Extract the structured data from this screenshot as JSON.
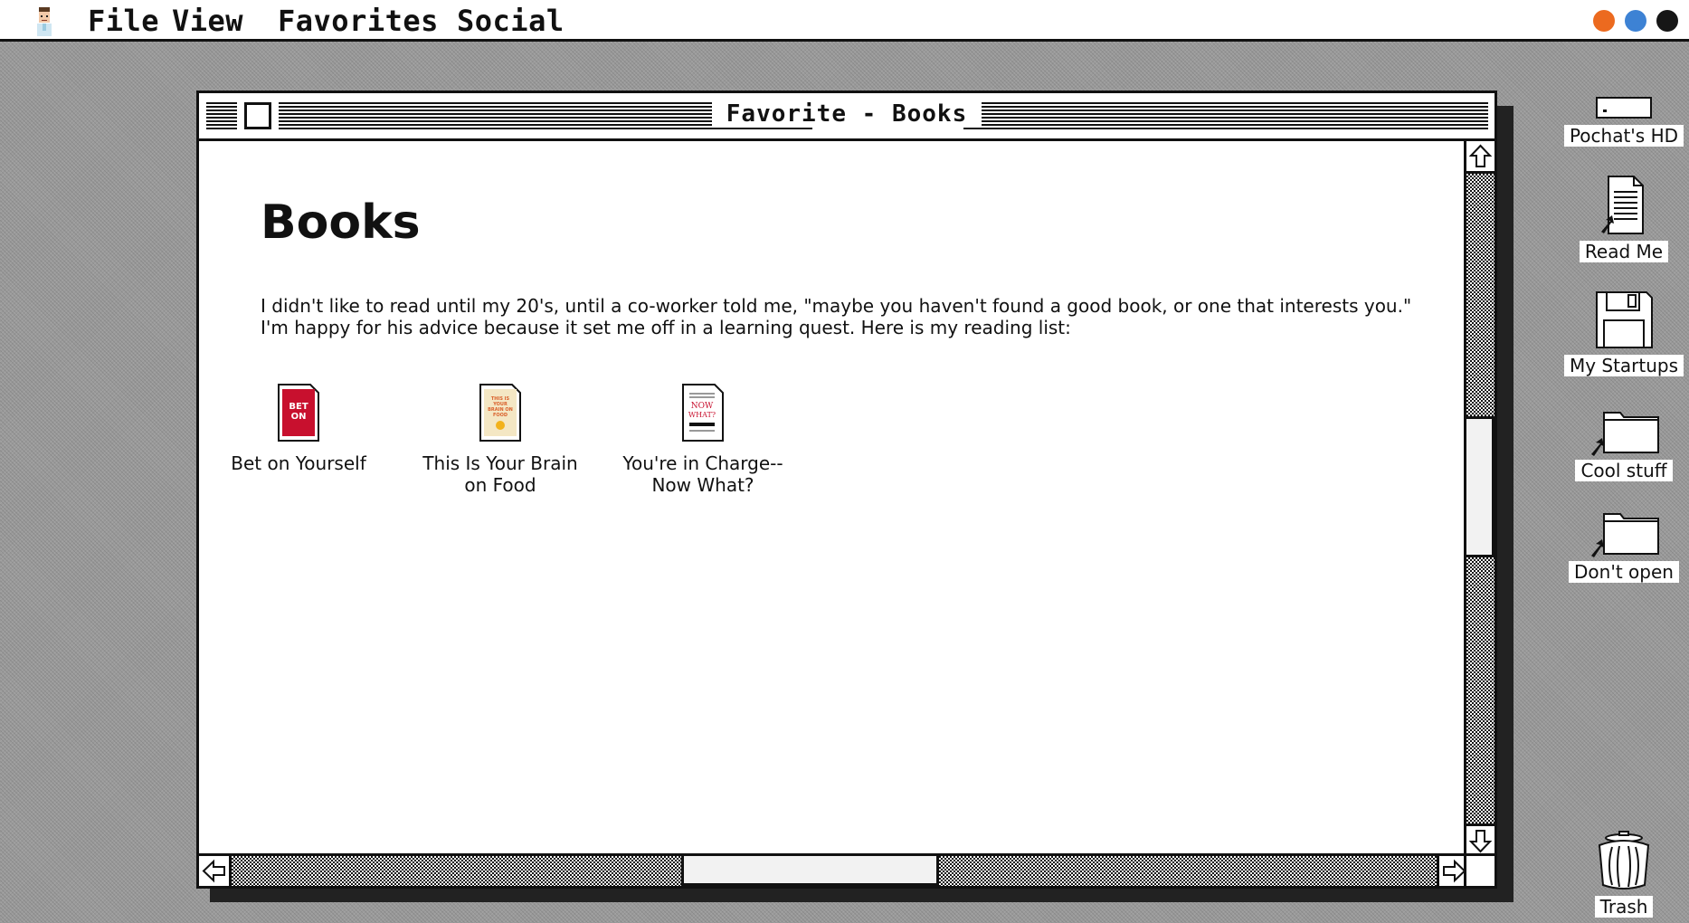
{
  "menubar": {
    "avatar_icon": "user-avatar-icon",
    "items": [
      "File",
      "View",
      "Favorites",
      "Social"
    ],
    "dots": [
      "#ec6a1f",
      "#3d82d4",
      "#161616"
    ]
  },
  "window": {
    "title": "Favorite - Books",
    "heading": "Books",
    "intro": "I didn't like to read until my 20's, until a co-worker told me, \"maybe you haven't found a good book, or one that interests you.\" I'm happy for his advice because it set me off in a learning quest. Here is my reading list:",
    "books": [
      {
        "label": "Bet on Yourself",
        "cover_text": "BET ON",
        "cover_color": "#c8102e"
      },
      {
        "label": "This Is Your Brain on Food",
        "cover_text": "THIS IS YOUR BRAIN ON FOOD",
        "cover_color": "#f4e7c4"
      },
      {
        "label": "You're in Charge-- Now What?",
        "cover_text": "NOW WHAT?",
        "cover_color": "#ffffff"
      }
    ]
  },
  "desktop": {
    "icons": [
      {
        "label": "Pochat's HD",
        "icon": "hard-drive-icon"
      },
      {
        "label": "Read Me",
        "icon": "document-alias-icon"
      },
      {
        "label": "My Startups",
        "icon": "floppy-disk-icon"
      },
      {
        "label": "Cool stuff",
        "icon": "folder-alias-icon"
      },
      {
        "label": "Don't open",
        "icon": "folder-alias-icon"
      },
      {
        "label": "Trash",
        "icon": "trash-can-icon"
      }
    ]
  }
}
